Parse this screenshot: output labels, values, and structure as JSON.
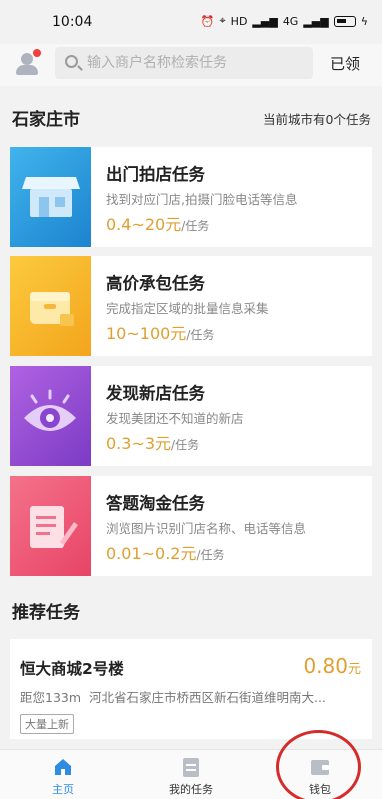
{
  "status_bar": {
    "time": "10:04",
    "network_hd": "HD",
    "network_4g": "4G"
  },
  "header": {
    "search_placeholder": "输入商户名称检索任务",
    "claimed_label": "已领"
  },
  "city": {
    "name": "石家庄市",
    "task_count_text": "当前城市有0个任务"
  },
  "tasks": [
    {
      "title": "出门拍店任务",
      "desc": "找到对应门店,拍摄门脸电话等信息",
      "price": "0.4~20元",
      "unit": "/任务",
      "icon": "storefront-icon",
      "color": "#2a9be0"
    },
    {
      "title": "高价承包任务",
      "desc": "完成指定区域的批量信息采集",
      "price": "10~100元",
      "unit": "/任务",
      "icon": "package-box-icon",
      "color": "#f8b52c"
    },
    {
      "title": "发现新店任务",
      "desc": "发现美团还不知道的新店",
      "price": "0.3~3元",
      "unit": "/任务",
      "icon": "eye-icon",
      "color": "#9650d4"
    },
    {
      "title": "答题淘金任务",
      "desc": "浏览图片识别门店名称、电话等信息",
      "price": "0.01~0.2元",
      "unit": "/任务",
      "icon": "document-edit-icon",
      "color": "#ee5a78"
    }
  ],
  "recommended": {
    "section_title": "推荐任务",
    "items": [
      {
        "name": "恒大商城2号楼",
        "reward": "0.80",
        "reward_unit": "元",
        "distance": "距您133m",
        "address": "河北省石家庄市桥西区新石街道维明南大...",
        "tag": "大量上新"
      }
    ]
  },
  "tabbar": {
    "items": [
      {
        "label": "主页",
        "icon": "home-icon",
        "active": true
      },
      {
        "label": "我的任务",
        "icon": "task-list-icon",
        "active": false
      },
      {
        "label": "钱包",
        "icon": "wallet-icon",
        "active": false
      }
    ]
  },
  "colors": {
    "accent": "#2f8de0",
    "price": "#e0a030",
    "annotation": "#d52b2b"
  }
}
